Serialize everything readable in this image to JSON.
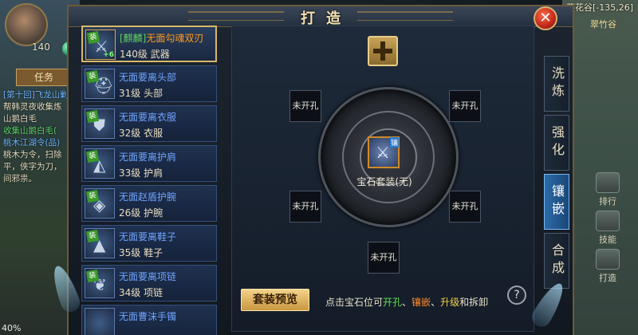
{
  "hud": {
    "avatar_level": "140",
    "quest_tab": "任务",
    "quest_lines": [
      {
        "text": "[第十回]飞龙山剿",
        "color": "blue"
      },
      {
        "text": "帮韩灵夜收集炼",
        "color": "white"
      },
      {
        "text": "山鹅白毛",
        "color": "white"
      },
      {
        "text": "收集山鹅白毛(",
        "color": "green"
      },
      {
        "text": "桃木江湖令(品)",
        "color": "blue"
      },
      {
        "text": "桃木为令，扫除",
        "color": "white"
      },
      {
        "text": "平，侠字为刀，",
        "color": "white"
      },
      {
        "text": "间邪祟。",
        "color": "white"
      }
    ],
    "location": "燕花谷[-135,26]",
    "map_label": "翠竹谷",
    "side_buttons": [
      "排行",
      "技能",
      "打造"
    ],
    "battery": "40%"
  },
  "panel": {
    "title": "打造",
    "close_label": "✕"
  },
  "items": [
    {
      "prefix": "[麒麟]",
      "name": "无面勾魂双刃",
      "level": "140级",
      "slot": "武器",
      "badge": "装",
      "plus": "+6",
      "glyph": "⚔",
      "selected": true
    },
    {
      "prefix": "",
      "name": "无面要离头部",
      "level": "31级",
      "slot": "头部",
      "badge": "装",
      "plus": "",
      "glyph": "⛑",
      "selected": false
    },
    {
      "prefix": "",
      "name": "无面要离衣服",
      "level": "32级",
      "slot": "衣服",
      "badge": "装",
      "plus": "",
      "glyph": "⛊",
      "selected": false
    },
    {
      "prefix": "",
      "name": "无面要离护肩",
      "level": "33级",
      "slot": "护肩",
      "badge": "装",
      "plus": "",
      "glyph": "◭",
      "selected": false
    },
    {
      "prefix": "",
      "name": "无面赵盾护腕",
      "level": "26级",
      "slot": "护腕",
      "badge": "装",
      "plus": "",
      "glyph": "◈",
      "selected": false
    },
    {
      "prefix": "",
      "name": "无面要离鞋子",
      "level": "35级",
      "slot": "鞋子",
      "badge": "装",
      "plus": "",
      "glyph": "▲",
      "selected": false
    },
    {
      "prefix": "",
      "name": "无面要离项链",
      "level": "34级",
      "slot": "项链",
      "badge": "装",
      "plus": "",
      "glyph": "❦",
      "selected": false
    },
    {
      "prefix": "",
      "name": "无面曹沫手镯",
      "level": "",
      "slot": "",
      "badge": "",
      "plus": "",
      "glyph": "",
      "selected": false
    }
  ],
  "sockets": {
    "empty_label": "未开孔",
    "center_label": "宝石套装(无)",
    "center_badge": "镶",
    "center_glyph": "⚔"
  },
  "footer": {
    "preview_label": "套装预览",
    "hint_pre": "点击宝石位可",
    "hint_open": "开孔",
    "hint_sep1": "、",
    "hint_inlay": "镶嵌",
    "hint_sep2": "、",
    "hint_upgrade": "升级",
    "hint_post": "和拆卸",
    "help_label": "?"
  },
  "tabs": [
    {
      "label": "洗炼",
      "active": false
    },
    {
      "label": "强化",
      "active": false
    },
    {
      "label": "镶嵌",
      "active": true
    },
    {
      "label": "合成",
      "active": false
    }
  ]
}
